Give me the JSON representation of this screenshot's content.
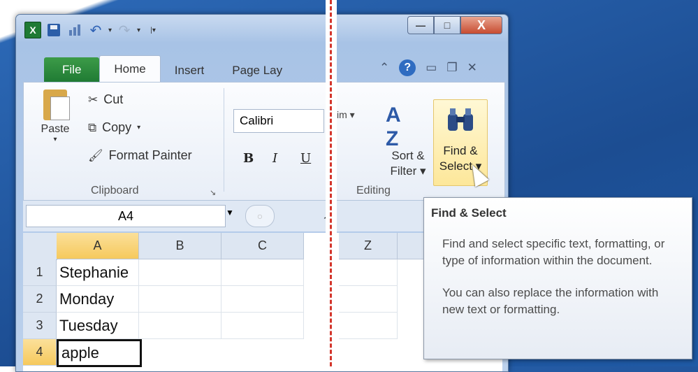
{
  "quick_access": {
    "icons": [
      "excel-icon",
      "save-icon",
      "chart-icon",
      "undo-icon",
      "redo-icon",
      "customize-icon"
    ]
  },
  "window_controls": {
    "minimize": "—",
    "maximize": "□",
    "close": "X"
  },
  "tabs": [
    {
      "label": "File"
    },
    {
      "label": "Home"
    },
    {
      "label": "Insert"
    },
    {
      "label": "Page Lay"
    }
  ],
  "ribbon": {
    "clipboard": {
      "paste": "Paste",
      "cut": "Cut",
      "copy": "Copy",
      "format_painter": "Format Painter",
      "group_label": "Clipboard"
    },
    "font": {
      "name": "Calibri",
      "bold": "B",
      "italic": "I",
      "underline": "U"
    },
    "editing": {
      "fragment": "im ▾",
      "sort_filter": "Sort & Filter ▾",
      "find_select_line1": "Find &",
      "find_select_line2": "Select ▾",
      "group_label": "Editing"
    }
  },
  "formula_bar": {
    "name_box": "A4",
    "fx": "f"
  },
  "sheet": {
    "columns": [
      "A",
      "B",
      "C",
      "Z"
    ],
    "rows": [
      {
        "num": "1",
        "a": "Stephanie"
      },
      {
        "num": "2",
        "a": "Monday"
      },
      {
        "num": "3",
        "a": "Tuesday"
      },
      {
        "num": "4",
        "a": "apple"
      }
    ],
    "selected_cell": "A4"
  },
  "tooltip": {
    "title": "Find & Select",
    "p1": "Find and select specific text, formatting, or type of information within the document.",
    "p2": "You can also replace the information with new text or formatting."
  }
}
